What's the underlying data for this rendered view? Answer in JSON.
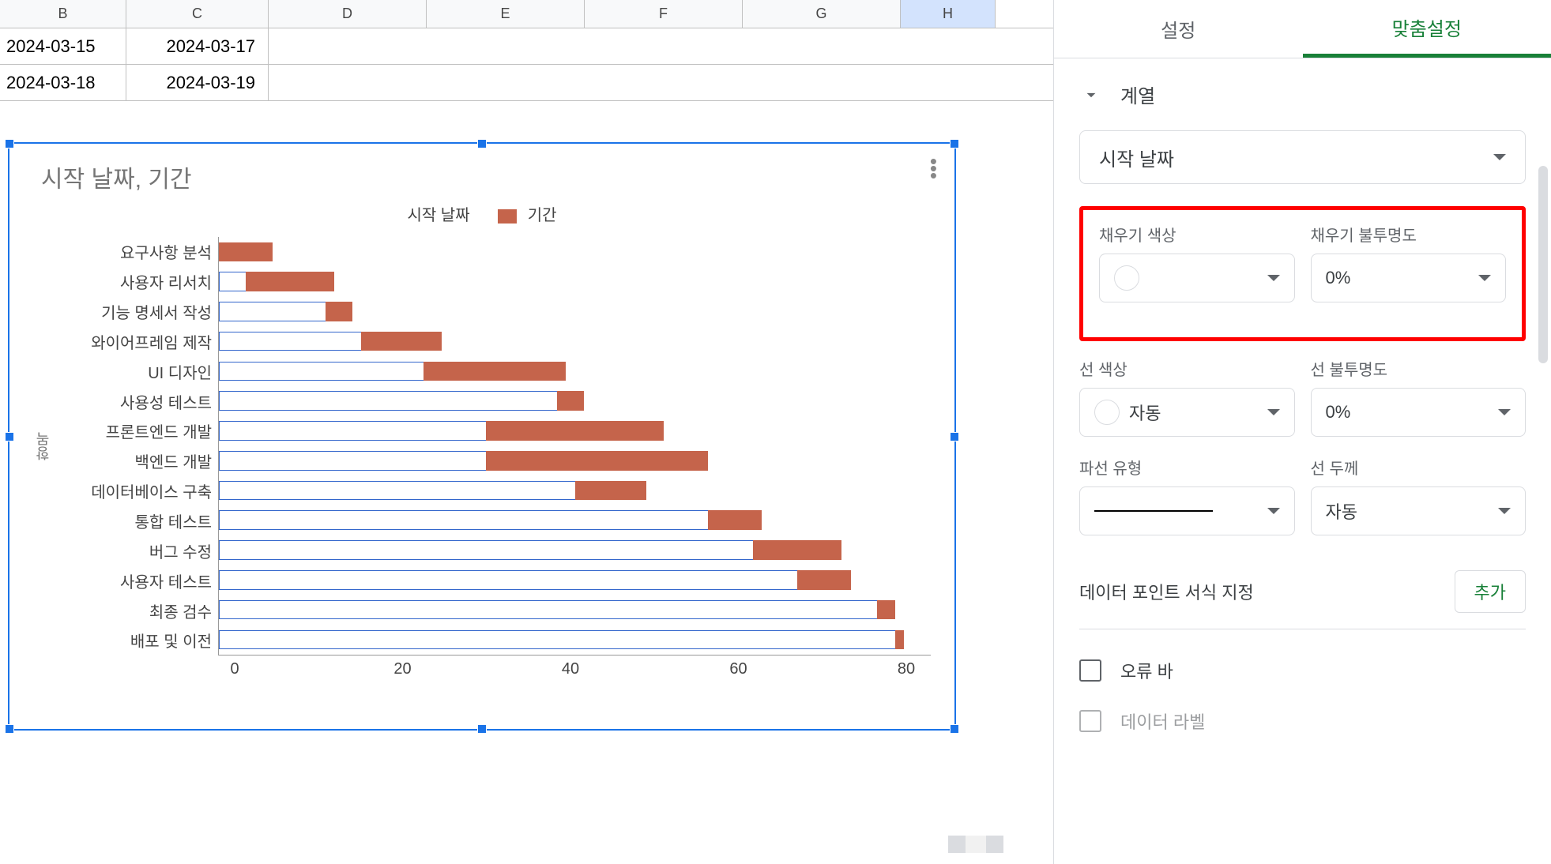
{
  "columns": [
    "B",
    "C",
    "D",
    "E",
    "F",
    "G",
    "H"
  ],
  "rows": [
    {
      "b": "2024-03-15",
      "c": "2024-03-17"
    },
    {
      "b": "2024-03-18",
      "c": "2024-03-19"
    }
  ],
  "chart": {
    "title": "시작 날짜, 기간",
    "legend": {
      "series1": "시작 날짜",
      "series2": "기간"
    },
    "y_axis_label": "항목"
  },
  "chart_data": {
    "type": "bar",
    "orientation": "horizontal",
    "stacked": true,
    "title": "시작 날짜, 기간",
    "xlabel": "",
    "ylabel": "항목",
    "xlim": [
      0,
      80
    ],
    "categories": [
      "요구사항 분석",
      "사용자 리서치",
      "기능 명세서 작성",
      "와이어프레임 제작",
      "UI 디자인",
      "사용성 테스트",
      "프론트엔드 개발",
      "백엔드 개발",
      "데이터베이스 구축",
      "통합 테스트",
      "버그 수정",
      "사용자 테스트",
      "최종 검수",
      "배포 및 이전"
    ],
    "series": [
      {
        "name": "시작 날짜",
        "color": "transparent",
        "values": [
          0,
          3,
          12,
          16,
          23,
          38,
          30,
          30,
          40,
          55,
          60,
          65,
          74,
          76
        ]
      },
      {
        "name": "기간",
        "color": "#c5644b",
        "values": [
          6,
          10,
          3,
          9,
          16,
          3,
          20,
          25,
          8,
          6,
          10,
          6,
          2,
          1
        ]
      }
    ],
    "x_ticks": [
      0,
      20,
      40,
      60,
      80
    ]
  },
  "sidebar": {
    "tabs": {
      "settings": "설정",
      "customize": "맞춤설정"
    },
    "section": "계열",
    "series_select": "시작 날짜",
    "fields": {
      "fill_color": "채우기 색상",
      "fill_opacity": "채우기 불투명도",
      "fill_opacity_value": "0%",
      "line_color": "선 색상",
      "line_color_value": "자동",
      "line_opacity": "선 불투명도",
      "line_opacity_value": "0%",
      "dash_type": "파선 유형",
      "line_width": "선 두께",
      "line_width_value": "자동"
    },
    "data_point_format": "데이터 포인트 서식 지정",
    "add_button": "추가",
    "error_bar": "오류 바",
    "data_label": "데이터 라벨"
  }
}
